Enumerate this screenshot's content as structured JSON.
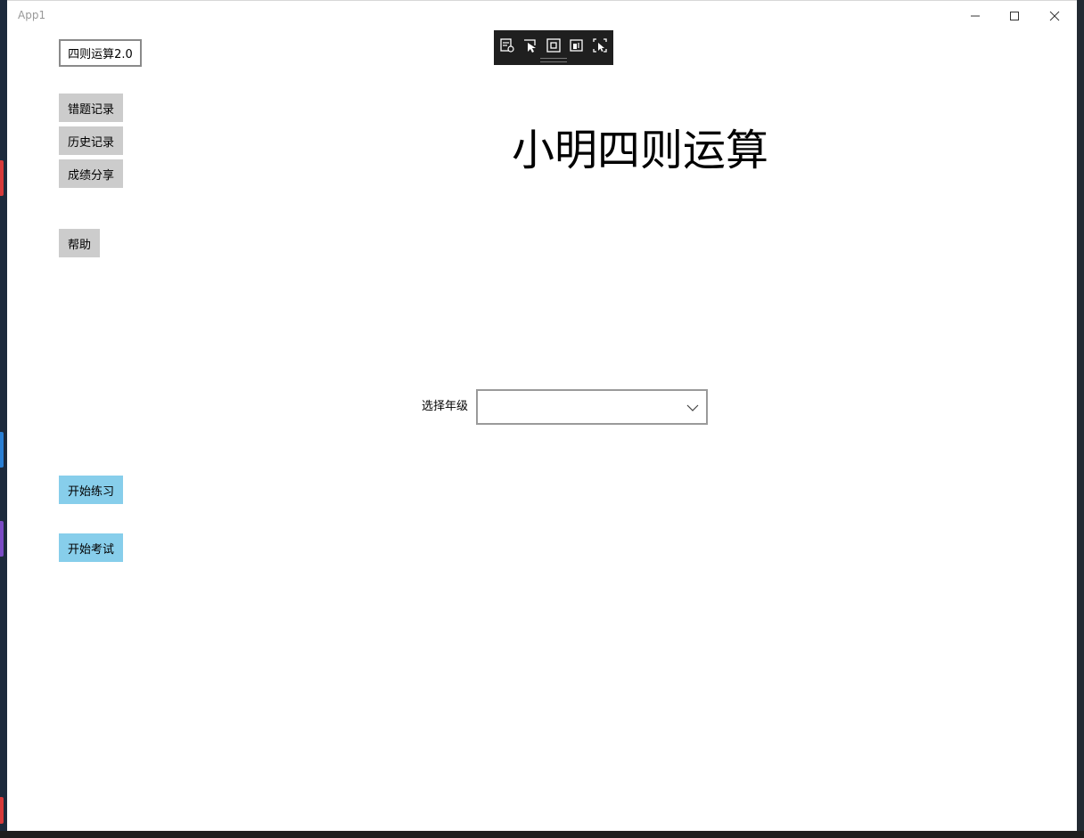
{
  "window": {
    "title": "App1"
  },
  "app": {
    "version_label": "四则运算2.0",
    "main_title": "小明四则运算"
  },
  "sidebar": {
    "wrong_records": "错题记录",
    "history_records": "历史记录",
    "score_share": "成绩分享",
    "help": "帮助",
    "start_practice": "开始练习",
    "start_exam": "开始考试"
  },
  "grade": {
    "label": "选择年级",
    "selected": ""
  },
  "colors": {
    "grey_button": "#cccccc",
    "blue_button": "#87ceeb",
    "toolbar_bg": "#1f1f1f"
  },
  "icons": {
    "debug_toolbar": [
      "live-visual-tree-icon",
      "select-element-icon",
      "display-layout-adorners-icon",
      "track-focus-icon",
      "preview-selection-icon"
    ],
    "window_controls": [
      "minimize-icon",
      "maximize-icon",
      "close-icon"
    ],
    "dropdown": "chevron-down-icon"
  }
}
